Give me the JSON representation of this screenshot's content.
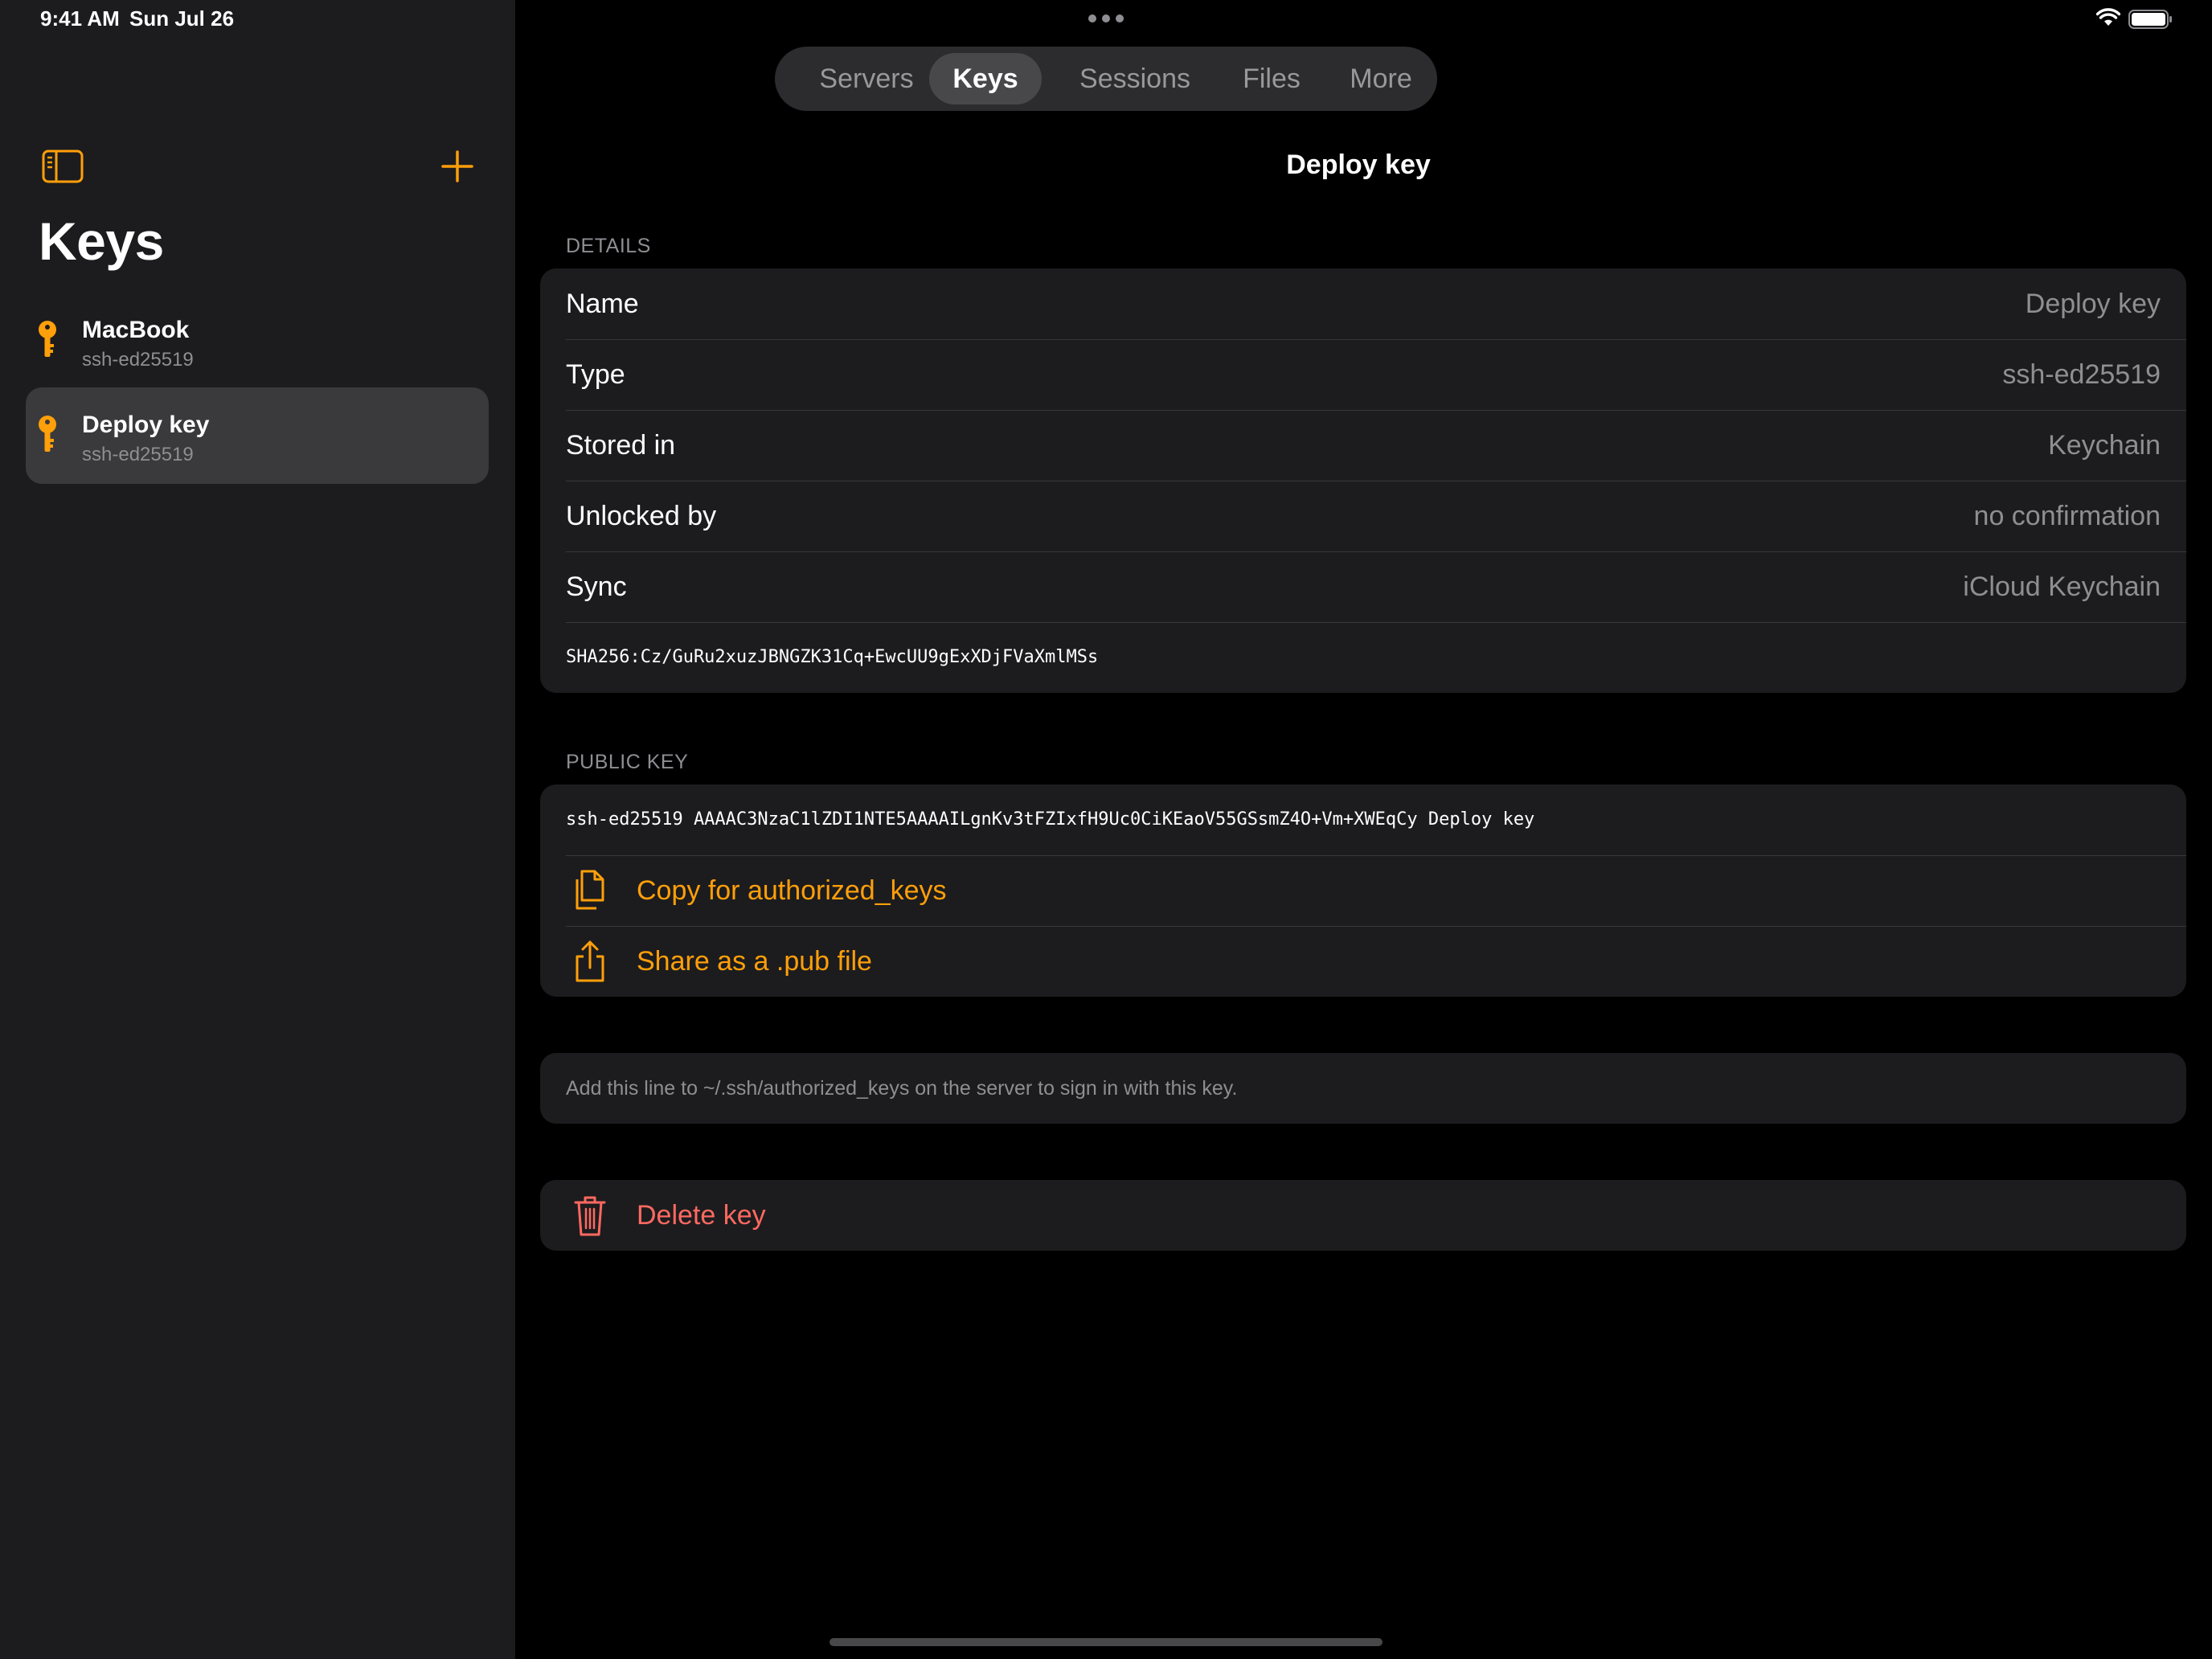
{
  "status_bar": {
    "time": "9:41 AM",
    "date": "Sun Jul 26"
  },
  "sidebar": {
    "title": "Keys",
    "keys": [
      {
        "name": "MacBook",
        "type": "ssh-ed25519",
        "selected": false
      },
      {
        "name": "Deploy key",
        "type": "ssh-ed25519",
        "selected": true
      }
    ]
  },
  "tabs": [
    {
      "label": "Servers",
      "active": false
    },
    {
      "label": "Keys",
      "active": true
    },
    {
      "label": "Sessions",
      "active": false
    },
    {
      "label": "Files",
      "active": false
    },
    {
      "label": "More",
      "active": false
    }
  ],
  "detail": {
    "title": "Deploy key",
    "details_header": "DETAILS",
    "rows": [
      {
        "label": "Name",
        "value": "Deploy key"
      },
      {
        "label": "Type",
        "value": "ssh-ed25519"
      },
      {
        "label": "Stored in",
        "value": "Keychain"
      },
      {
        "label": "Unlocked by",
        "value": "no confirmation"
      },
      {
        "label": "Sync",
        "value": "iCloud Keychain"
      }
    ],
    "fingerprint": "SHA256:Cz/GuRu2xuzJBNGZK31Cq+EwcUU9gExXDjFVaXmlMSs",
    "public_key_header": "PUBLIC KEY",
    "public_key": "ssh-ed25519 AAAAC3NzaC1lZDI1NTE5AAAAILgnKv3tFZIxfH9Uc0CiKEaoV55GSsmZ4O+Vm+XWEqCy Deploy key",
    "copy_label": "Copy for authorized_keys",
    "share_label": "Share as a .pub file",
    "note": "Add this line to ~/.ssh/authorized_keys on the server to sign in with this key.",
    "delete_label": "Delete key"
  },
  "colors": {
    "accent": "#ff9f0a",
    "destructive": "#ff6961",
    "background": "#000000",
    "card": "#1c1c1e"
  },
  "icons": [
    "sidebar-toggle-icon",
    "plus-icon",
    "key-icon",
    "copy-icon",
    "share-icon",
    "trash-icon",
    "wifi-icon",
    "battery-icon"
  ]
}
